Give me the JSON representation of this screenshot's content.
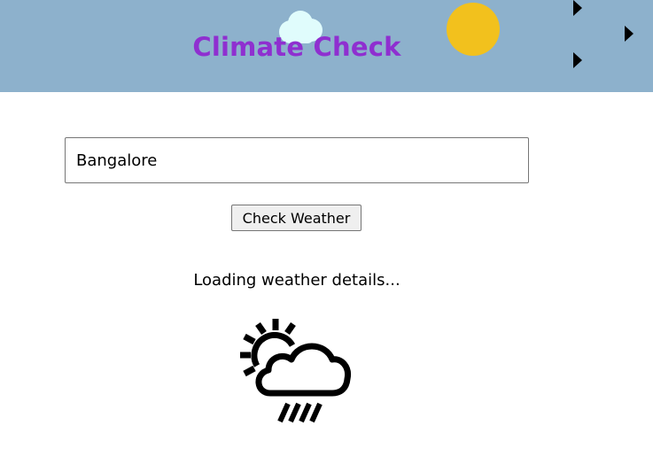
{
  "header": {
    "title": "Climate Check",
    "colors": {
      "background": "#8db1cc",
      "title": "#8f2fd0",
      "sun": "#f2c11d",
      "cloud": "#e0fcfc"
    },
    "decorations": [
      "cloud-icon",
      "sun-icon",
      "bird-icon",
      "bird-icon",
      "bird-icon"
    ]
  },
  "search": {
    "value": "Bangalore",
    "placeholder": ""
  },
  "actions": {
    "check_label": "Check Weather"
  },
  "status": {
    "message": "Loading weather details...",
    "icon": "partly-cloudy-rain-icon"
  }
}
